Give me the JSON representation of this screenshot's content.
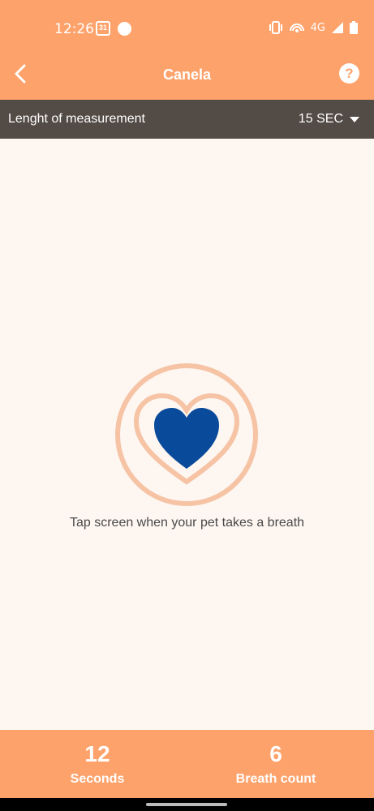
{
  "status_bar": {
    "time": "12:26",
    "calendar_day": "31",
    "network": "4G"
  },
  "app_bar": {
    "title": "Canela",
    "help_label": "?"
  },
  "settings": {
    "label": "Lenght of measurement",
    "duration_value": "15 SEC"
  },
  "main": {
    "instruction": "Tap screen when your pet takes a breath"
  },
  "stats": {
    "seconds_value": "12",
    "seconds_label": "Seconds",
    "breath_value": "6",
    "breath_label": "Breath count"
  },
  "colors": {
    "primary": "#fea26b",
    "settings_bar": "#534b45",
    "heart": "#0a4a9a",
    "ring": "#f6c3a4"
  }
}
